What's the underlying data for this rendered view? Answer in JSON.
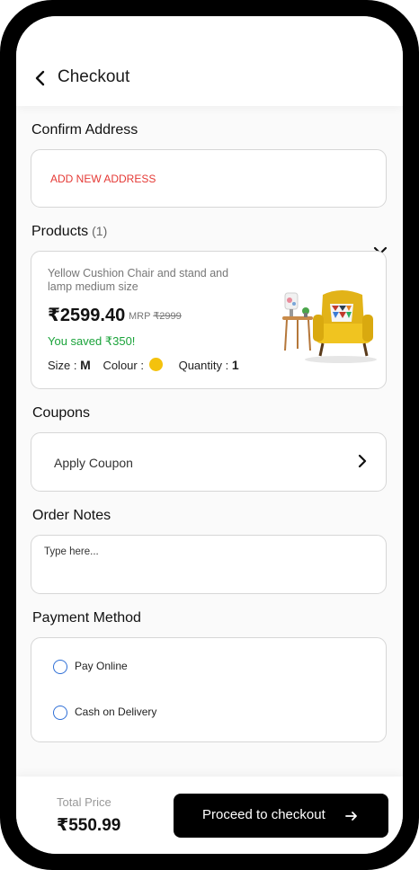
{
  "header": {
    "title": "Checkout",
    "back_icon": "chevron-left-icon"
  },
  "address": {
    "section_label": "Confirm Address",
    "add_new_label": "ADD NEW ADDRESS",
    "add_new_color": "#E53935"
  },
  "products": {
    "section_label": "Products",
    "count_label": "(1)",
    "expand_icon": "chevron-down-icon",
    "items": [
      {
        "name": "Yellow Cushion Chair and stand and lamp medium size",
        "price": "₹2599.40",
        "mrp_label": "MRP",
        "mrp_value": "₹2999",
        "saved_text": "You saved ₹350!",
        "saved_color": "#1AA33A",
        "size_label": "Size :",
        "size_value": "M",
        "colour_label": "Colour :",
        "colour_value": "#F4C20D",
        "quantity_label": "Quantity :",
        "quantity_value": "1"
      }
    ]
  },
  "coupons": {
    "section_label": "Coupons",
    "apply_label": "Apply Coupon",
    "chevron_icon": "chevron-right-icon"
  },
  "order_notes": {
    "section_label": "Order Notes",
    "placeholder": "Type here..."
  },
  "payment": {
    "section_label": "Payment Method",
    "options": [
      {
        "label": "Pay Online",
        "selected": false
      },
      {
        "label": "Cash on Delivery",
        "selected": false
      }
    ],
    "radio_color": "#2F6FD6"
  },
  "footer": {
    "total_label": "Total Price",
    "total_value": "₹550.99",
    "checkout_label": "Proceed to checkout",
    "checkout_icon": "arrow-right-icon"
  }
}
